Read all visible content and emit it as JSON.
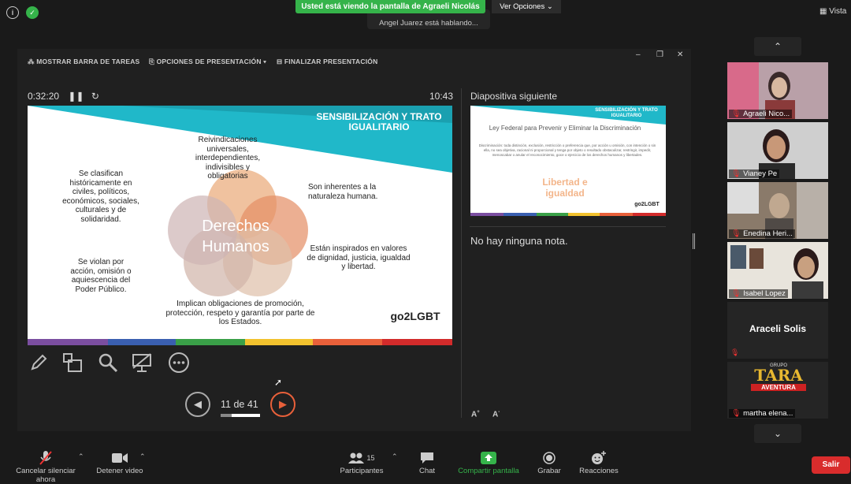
{
  "top": {
    "share_banner": "Usted está viendo la pantalla de Agraeli  Nicolás",
    "view_options": "Ver Opciones ⌄",
    "speaking": "Angel Juarez está hablando...",
    "view_label": "Vista"
  },
  "presenter": {
    "show_taskbar": "MOSTRAR BARRA DE TAREAS",
    "presentation_options": "OPCIONES DE PRESENTACIÓN ▾",
    "end_presentation": "FINALIZAR PRESENTACIÓN",
    "elapsed": "0:32:20",
    "clock": "10:43",
    "next_slide_label": "Diapositiva siguiente",
    "notes": "No hay ninguna nota.",
    "page": "11 de 41",
    "progress": 0.27
  },
  "slide": {
    "title_line1": "SENSIBILIZACIÓN Y TRATO",
    "title_line2": "IGUALITARIO",
    "center_line1": "Derechos",
    "center_line2": "Humanos",
    "top_text": "Reivindicaciones universales, interdependientes, indivisibles y obligatorias",
    "left_top_text": "Se clasifican históricamente en civiles, políticos, económicos, sociales, culturales y de solidaridad.",
    "right_top_text": "Son inherentes a la naturaleza humana.",
    "left_bottom_text": "Se violan por acción, omisión o aquiescencia del Poder Público.",
    "right_bottom_text": "Están inspirados en valores de dignidad, justicia, igualdad y libertad.",
    "bottom_text": "Implican obligaciones de promoción, protección, respeto y garantía por parte de los Estados.",
    "logo": "go2LGBT"
  },
  "next_slide": {
    "title_line1": "SENSIBILIZACIÓN Y TRATO",
    "title_line2": "IGUALITARIO",
    "heading": "Ley Federal para Prevenir y Eliminar la Discriminación",
    "body": "Discriminación: toda distinción, exclusión, restricción o preferencia que, por acción u omisión, con intención o sin ella, no sea objetiva, racional ni proporcional y tenga por objeto o resultado obstaculizar, restringir, impedir, menoscabar o anular el reconocimiento, goce o ejercicio de los derechos humanos y libertades.",
    "highlight_line1": "Libertad e",
    "highlight_line2": "igualdad",
    "logo": "go2LGBT"
  },
  "participants": [
    {
      "name": "Agraeli  Nico..."
    },
    {
      "name": "Vianey Pe"
    },
    {
      "name": "Enedina Heri..."
    },
    {
      "name": "Isabel Lopez"
    },
    {
      "name": "Araceli Solis"
    },
    {
      "name": "martha elena..."
    }
  ],
  "tile_logo": {
    "line1": "TARA",
    "line2": "AVENTURA",
    "small": "GRUPO"
  },
  "bottom": {
    "mute": "Cancelar silenciar ahora",
    "video": "Detener video",
    "participants": "Participantes",
    "participants_count": "15",
    "chat": "Chat",
    "share": "Compartir pantalla",
    "record": "Grabar",
    "reactions": "Reacciones",
    "leave": "Salir"
  },
  "colors": {
    "teal": "#20b8c9",
    "green": "#35b34a",
    "red": "#d92c2c",
    "orange": "#e8603a"
  }
}
